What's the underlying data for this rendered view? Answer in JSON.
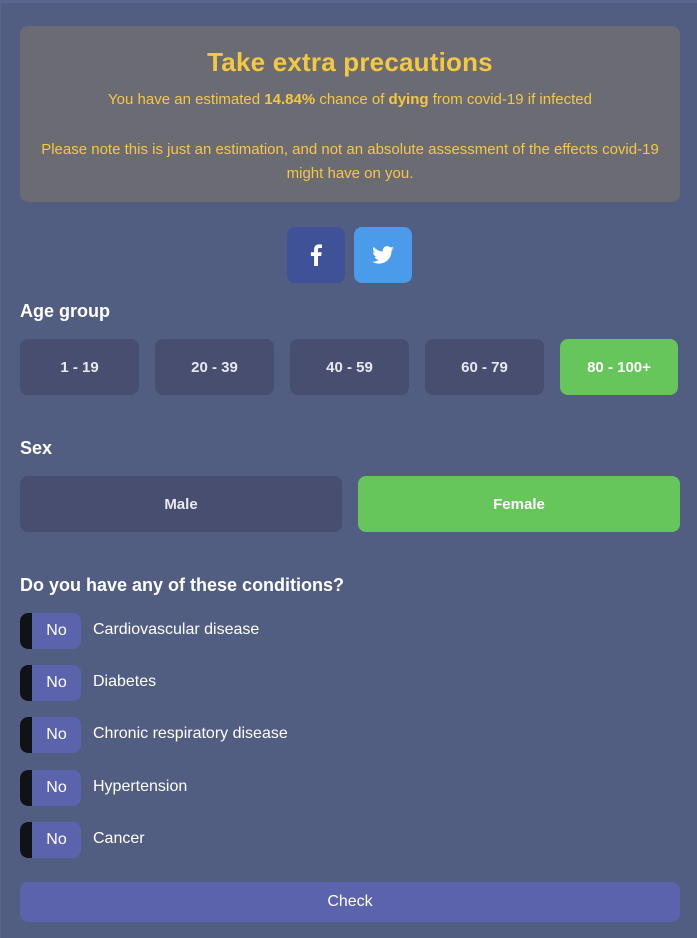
{
  "alert": {
    "title": "Take extra precautions",
    "line_prefix": "You have an estimated ",
    "percent": "14.84%",
    "line_mid": " chance of ",
    "emph": "dying",
    "line_suffix": " from covid-19 if infected",
    "note": "Please note this is just an estimation, and not an absolute assessment of the effects covid-19 might have on you.",
    "text_color": "#f5c842"
  },
  "share": [
    {
      "icon": "facebook-icon",
      "color": "#3f5298"
    },
    {
      "icon": "twitter-icon",
      "color": "#4a9be9"
    }
  ],
  "age": {
    "title": "Age group",
    "options": [
      "1 - 19",
      "20 - 39",
      "40 - 59",
      "60 - 79",
      "80 - 100+"
    ],
    "selected": "80 - 100+"
  },
  "sex": {
    "title": "Sex",
    "options": [
      "Male",
      "Female"
    ],
    "selected": "Female"
  },
  "conditions": {
    "title": "Do you have any of these conditions?",
    "items": [
      {
        "label": "Cardiovascular disease",
        "value": "No"
      },
      {
        "label": "Diabetes",
        "value": "No"
      },
      {
        "label": "Chronic respiratory disease",
        "value": "No"
      },
      {
        "label": "Hypertension",
        "value": "No"
      },
      {
        "label": "Cancer",
        "value": "No"
      }
    ]
  },
  "check_label": "Check",
  "colors": {
    "selected": "#66c65b",
    "accent": "#5b63ad",
    "background": "#525d82"
  }
}
